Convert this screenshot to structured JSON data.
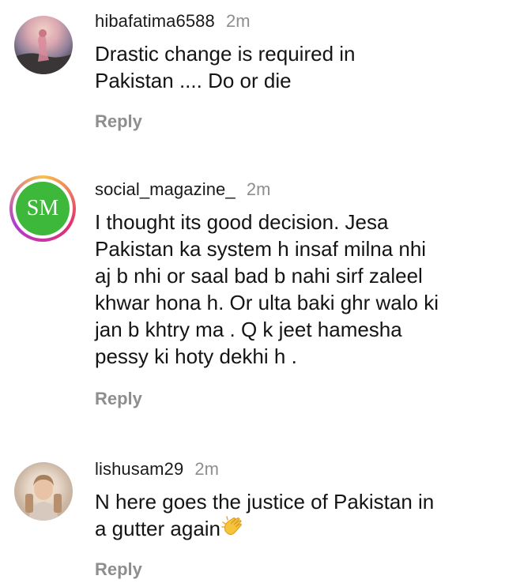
{
  "comments": [
    {
      "username": "hibafatima6588",
      "time": "2m",
      "text_lines": [
        "Drastic change is required in",
        "Pakistan .... Do or die"
      ],
      "reply_label": "Reply",
      "avatar_icon": "user-photo-avatar"
    },
    {
      "username": "social_magazine_",
      "time": "2m",
      "avatar_text": "SM",
      "text_lines": [
        "I thought its good decision. Jesa",
        "Pakistan ka system h insaf milna nhi",
        "aj b nhi or saal bad b nahi sirf zaleel",
        "khwar hona h. Or ulta baki ghr walo ki",
        "jan b khtry ma . Q k jeet hamesha",
        "pessy ki hoty dekhi h ."
      ],
      "reply_label": "Reply",
      "colors": {
        "logo_green": "#3db83a"
      }
    },
    {
      "username": "lishusam29",
      "time": "2m",
      "text_lines": [
        "N here goes the justice of Pakistan in",
        "a gutter again"
      ],
      "emoji": "clapping-hands",
      "reply_label": "Reply",
      "avatar_icon": "user-photo-avatar"
    }
  ],
  "colors": {
    "text": "#141414",
    "muted": "#8e8e8e",
    "background": "#ffffff"
  }
}
